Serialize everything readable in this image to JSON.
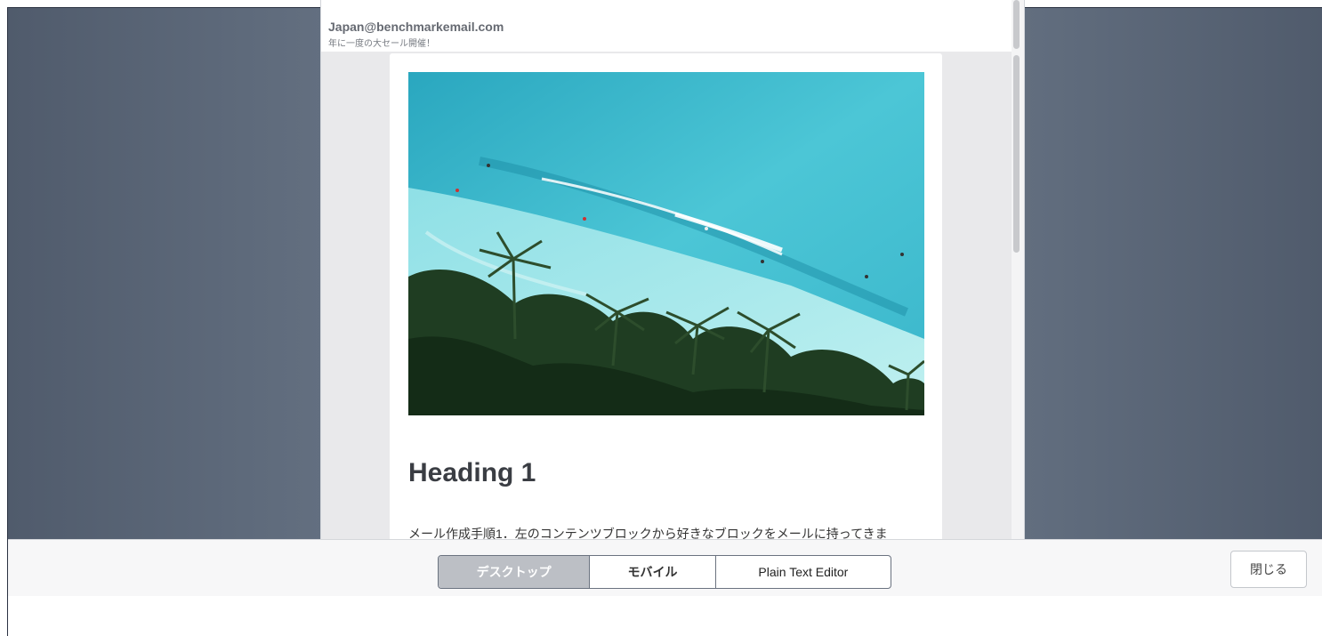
{
  "preview": {
    "from_email": "Japan@benchmarkemail.com",
    "subject": "年に一度の大セール開催！",
    "heading": "Heading 1",
    "body_text": "メール作成手順1．左のコンテンツブロックから好きなブロックをメールに持ってきま",
    "hero_image_alt": "tropical beach with palm trees and surfers"
  },
  "view_toggle": {
    "desktop_label": "デスクトップ",
    "mobile_label": "モバイル",
    "plain_text_label": "Plain Text Editor",
    "selected": "desktop"
  },
  "actions": {
    "close_label": "閉じる"
  },
  "colors": {
    "backdrop": "#6b7788",
    "active_tab": "#bcbfc5",
    "sea": "#4fc3d3"
  }
}
